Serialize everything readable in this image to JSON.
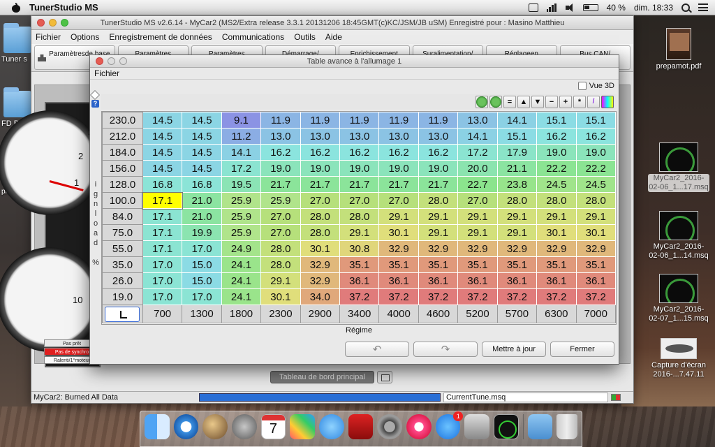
{
  "menubar": {
    "app_name": "TunerStudio MS",
    "battery": "40 %",
    "clock": "dim. 18:33"
  },
  "mainwin": {
    "title": "TunerStudio MS v2.6.14 - MyCar2 (MS2/Extra release 3.3.1  20131206 18:45GMT(c)KC/JSM/JB   uSM) Enregistré pour : Masino Matthieu",
    "menu": [
      "Fichier",
      "Options",
      "Enregistrement de données",
      "Communications",
      "Outils",
      "Aide"
    ],
    "toolbar": [
      "Paramètresde base",
      "Paramètres",
      "Paramètres d'allumage/",
      "Démarrage/",
      "Enrichissement",
      "Suralimentation/",
      "Réglageen",
      "Bus CAN/"
    ],
    "bottom_tab": "Tableau de bord principal",
    "status": {
      "left": "MyCar2: Burned All Data",
      "file": "CurrentTune.msq",
      "progress": 1.0
    },
    "gauge": {
      "ticks_top": [
        "1",
        "2",
        "3"
      ],
      "tick_bottom": "10"
    },
    "lamps": [
      "Pas prêt",
      "Pas de synchro",
      "Ralenti/1°moteur"
    ]
  },
  "dialog": {
    "title": "Table avance à l'allumage 1",
    "menu": "Fichier",
    "vue3d": "Vue 3D",
    "y_axis_label": [
      "i",
      "g",
      "n",
      "l",
      "o",
      "a",
      "d",
      "",
      "%"
    ],
    "x_axis_label": "Régime",
    "buttons": {
      "update": "Mettre à jour",
      "close": "Fermer"
    },
    "rpm": [
      700,
      1300,
      1800,
      2300,
      2900,
      3400,
      4000,
      4600,
      5200,
      5700,
      6300,
      7000
    ],
    "load": [
      "230.0",
      "212.0",
      "184.0",
      "156.0",
      "128.0",
      "100.0",
      "84.0",
      "75.0",
      "55.0",
      "35.0",
      "26.0",
      "19.0"
    ],
    "rpm_labels": [
      "700",
      "1300",
      "1800",
      "2300",
      "2900",
      "3400",
      "4000",
      "4600",
      "5200",
      "5700",
      "6300",
      "7000"
    ],
    "values": [
      [
        "14.5",
        "14.5",
        "9.1",
        "11.9",
        "11.9",
        "11.9",
        "11.9",
        "11.9",
        "13.0",
        "14.1",
        "15.1",
        "15.1"
      ],
      [
        "14.5",
        "14.5",
        "11.2",
        "13.0",
        "13.0",
        "13.0",
        "13.0",
        "13.0",
        "14.1",
        "15.1",
        "16.2",
        "16.2"
      ],
      [
        "14.5",
        "14.5",
        "14.1",
        "16.2",
        "16.2",
        "16.2",
        "16.2",
        "16.2",
        "17.2",
        "17.9",
        "19.0",
        "19.0"
      ],
      [
        "14.5",
        "14.5",
        "17.2",
        "19.0",
        "19.0",
        "19.0",
        "19.0",
        "19.0",
        "20.0",
        "21.1",
        "22.2",
        "22.2"
      ],
      [
        "16.8",
        "16.8",
        "19.5",
        "21.7",
        "21.7",
        "21.7",
        "21.7",
        "21.7",
        "22.7",
        "23.8",
        "24.5",
        "24.5"
      ],
      [
        "17.1",
        "21.0",
        "25.9",
        "25.9",
        "27.0",
        "27.0",
        "27.0",
        "28.0",
        "27.0",
        "28.0",
        "28.0",
        "28.0"
      ],
      [
        "17.1",
        "21.0",
        "25.9",
        "27.0",
        "28.0",
        "28.0",
        "29.1",
        "29.1",
        "29.1",
        "29.1",
        "29.1",
        "29.1"
      ],
      [
        "17.1",
        "19.9",
        "25.9",
        "27.0",
        "28.0",
        "29.1",
        "30.1",
        "29.1",
        "29.1",
        "29.1",
        "30.1",
        "30.1"
      ],
      [
        "17.1",
        "17.0",
        "24.9",
        "28.0",
        "30.1",
        "30.8",
        "32.9",
        "32.9",
        "32.9",
        "32.9",
        "32.9",
        "32.9"
      ],
      [
        "17.0",
        "15.0",
        "24.1",
        "28.0",
        "32.9",
        "35.1",
        "35.1",
        "35.1",
        "35.1",
        "35.1",
        "35.1",
        "35.1"
      ],
      [
        "17.0",
        "15.0",
        "24.1",
        "29.1",
        "32.9",
        "36.1",
        "36.1",
        "36.1",
        "36.1",
        "36.1",
        "36.1",
        "36.1"
      ],
      [
        "17.0",
        "17.0",
        "24.1",
        "30.1",
        "34.0",
        "37.2",
        "37.2",
        "37.2",
        "37.2",
        "37.2",
        "37.2",
        "37.2"
      ]
    ],
    "selected_row": 5,
    "selected_col": 0,
    "color_scale": {
      "min": 9.1,
      "max": 37.2
    }
  },
  "desktop": {
    "icons": [
      {
        "label": "prepamot.pdf"
      },
      {
        "label": "MyCar2_2016-02-06_1...17.msq"
      },
      {
        "label": "MyCar2_2016-02-06_1...14.msq"
      },
      {
        "label": "MyCar2_2016-02-07_1...15.msq"
      },
      {
        "label": "Capture d'écran 2016-...7.47.11"
      }
    ],
    "left_partials": [
      "Tuner s",
      "FD Breta",
      "Sites-pièces...5"
    ]
  },
  "dock": {
    "calendar_day": "7"
  }
}
